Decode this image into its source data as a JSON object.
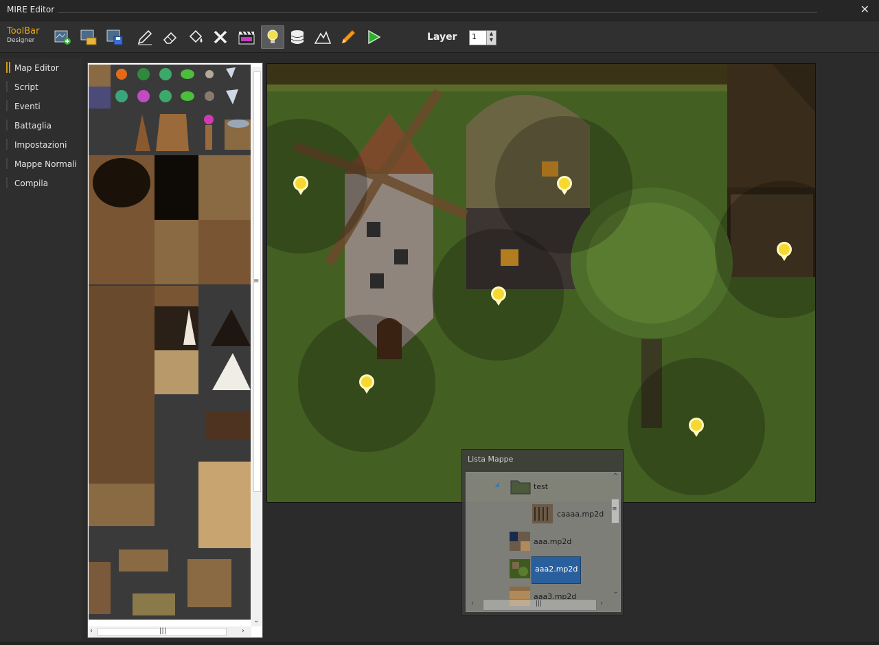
{
  "window": {
    "title": "MIRE Editor",
    "close_glyph": "✕"
  },
  "toolbar": {
    "label_main": "ToolBar",
    "label_sub": "Designer",
    "buttons": [
      {
        "name": "new-map-icon"
      },
      {
        "name": "open-map-icon"
      },
      {
        "name": "save-map-icon"
      },
      {
        "name": "pencil-draw-icon"
      },
      {
        "name": "eraser-icon"
      },
      {
        "name": "fill-bucket-icon"
      },
      {
        "name": "delete-x-icon"
      },
      {
        "name": "clapperboard-icon"
      },
      {
        "name": "lightbulb-icon",
        "active": true
      },
      {
        "name": "database-icon"
      },
      {
        "name": "mountain-icon"
      },
      {
        "name": "orange-pencil-icon"
      },
      {
        "name": "play-icon"
      }
    ],
    "layer_label": "Layer",
    "layer_value": "1"
  },
  "sidebar": {
    "items": [
      {
        "label": "Map Editor",
        "active": true
      },
      {
        "label": "Script"
      },
      {
        "label": "Eventi"
      },
      {
        "label": "Battaglia"
      },
      {
        "label": "Impostazioni"
      },
      {
        "label": "Mappe Normali"
      },
      {
        "label": "Compila"
      }
    ]
  },
  "map_list": {
    "title": "Lista Mappe",
    "items": [
      {
        "label": "test",
        "type": "folder",
        "expanded": true
      },
      {
        "label": "caaaa.mp2d",
        "type": "map",
        "child": true
      },
      {
        "label": "aaa.mp2d",
        "type": "map"
      },
      {
        "label": "aaa2.mp2d",
        "type": "map",
        "selected": true
      },
      {
        "label": "aaa3.mp2d",
        "type": "map"
      }
    ]
  },
  "colors": {
    "accent": "#d49a10",
    "selection": "#2a5f9e",
    "grass": "#3e5a1e"
  }
}
